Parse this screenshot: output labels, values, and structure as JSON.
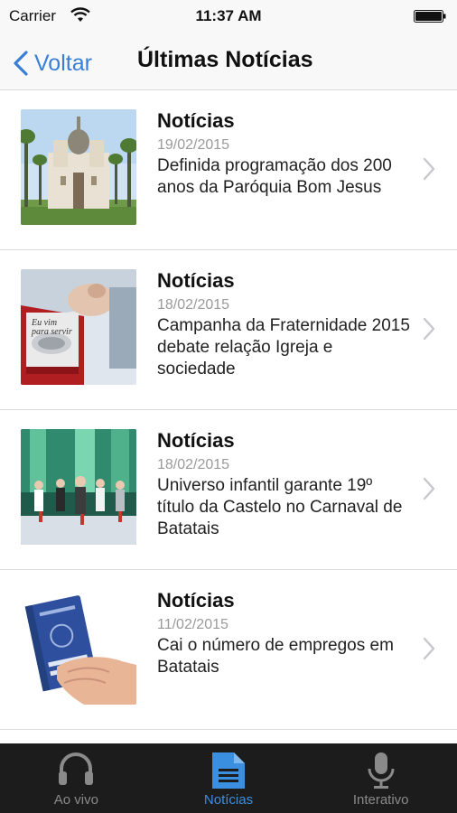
{
  "status_bar": {
    "carrier": "Carrier",
    "time": "11:37 AM"
  },
  "nav": {
    "back_label": "Voltar",
    "title": "Últimas Notícias"
  },
  "news": [
    {
      "category": "Notícias",
      "date": "19/02/2015",
      "headline": "Definida programação dos 200 anos da Paróquia Bom Jesus",
      "thumb_icon": "church-photo"
    },
    {
      "category": "Notícias",
      "date": "18/02/2015",
      "headline": "Campanha da Fraternidade 2015 debate relação Igreja e sociedade",
      "thumb_icon": "campaign-poster-photo"
    },
    {
      "category": "Notícias",
      "date": "18/02/2015",
      "headline": "Universo infantil garante 19º título da Castelo no Carnaval de Batatais",
      "thumb_icon": "carnival-parade-photo"
    },
    {
      "category": "Notícias",
      "date": "11/02/2015",
      "headline": "Cai o número de empregos em Batatais",
      "thumb_icon": "work-card-photo"
    }
  ],
  "tabs": [
    {
      "label": "Ao vivo",
      "icon": "headphones-icon",
      "active": false
    },
    {
      "label": "Notícias",
      "icon": "document-icon",
      "active": true
    },
    {
      "label": "Interativo",
      "icon": "microphone-icon",
      "active": false
    }
  ],
  "colors": {
    "accent": "#3a8fe0",
    "back_link": "#3a7fd5",
    "tab_bar_bg": "#1c1c1c"
  }
}
